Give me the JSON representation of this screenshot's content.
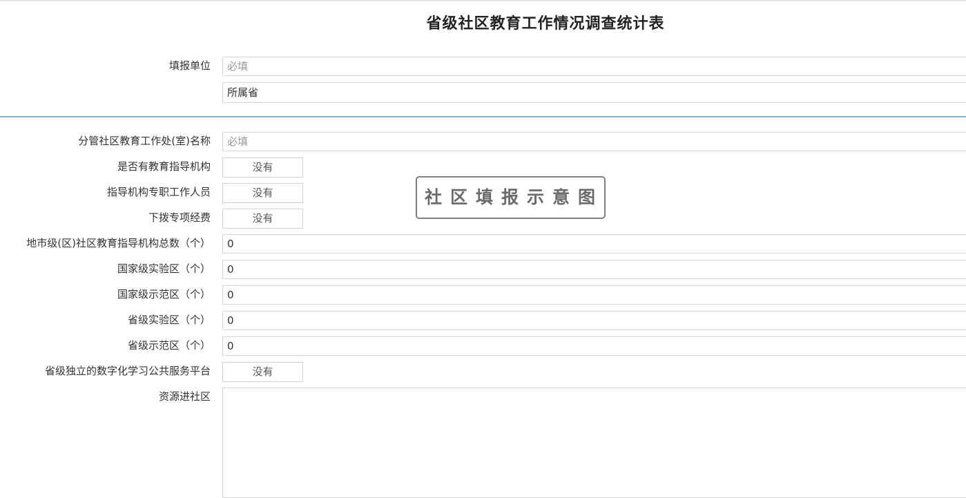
{
  "page": {
    "title": "省级社区教育工作情况调查统计表"
  },
  "section_unit": {
    "unit_label": "填报单位",
    "unit_placeholder": "必填",
    "province_value": "所属省"
  },
  "section_details": {
    "dept_name_label": "分管社区教育工作处(室)名称",
    "dept_name_placeholder": "必填",
    "has_guidance_org_label": "是否有教育指导机构",
    "has_guidance_org_value": "没有",
    "full_time_staff_label": "指导机构专职工作人员",
    "full_time_staff_value": "没有",
    "special_funds_label": "下拨专项经费",
    "special_funds_value": "没有",
    "city_orgs_total_label": "地市级(区)社区教育指导机构总数（个）",
    "city_orgs_total_value": "0",
    "national_experimental_label": "国家级实验区（个）",
    "national_experimental_value": "0",
    "national_demo_label": "国家级示范区（个）",
    "national_demo_value": "0",
    "provincial_experimental_label": "省级实验区（个）",
    "provincial_experimental_value": "0",
    "provincial_demo_label": "省级示范区（个）",
    "provincial_demo_value": "0",
    "digital_platform_label": "省级独立的数字化学习公共服务平台",
    "digital_platform_value": "没有",
    "resources_label": "资源进社区",
    "resources_value": ""
  },
  "watermark": {
    "text": "社区填报示意图"
  },
  "colors": {
    "divider": "#7fb6d4",
    "border": "#d7d7d7",
    "placeholder": "#9a9a9a"
  }
}
